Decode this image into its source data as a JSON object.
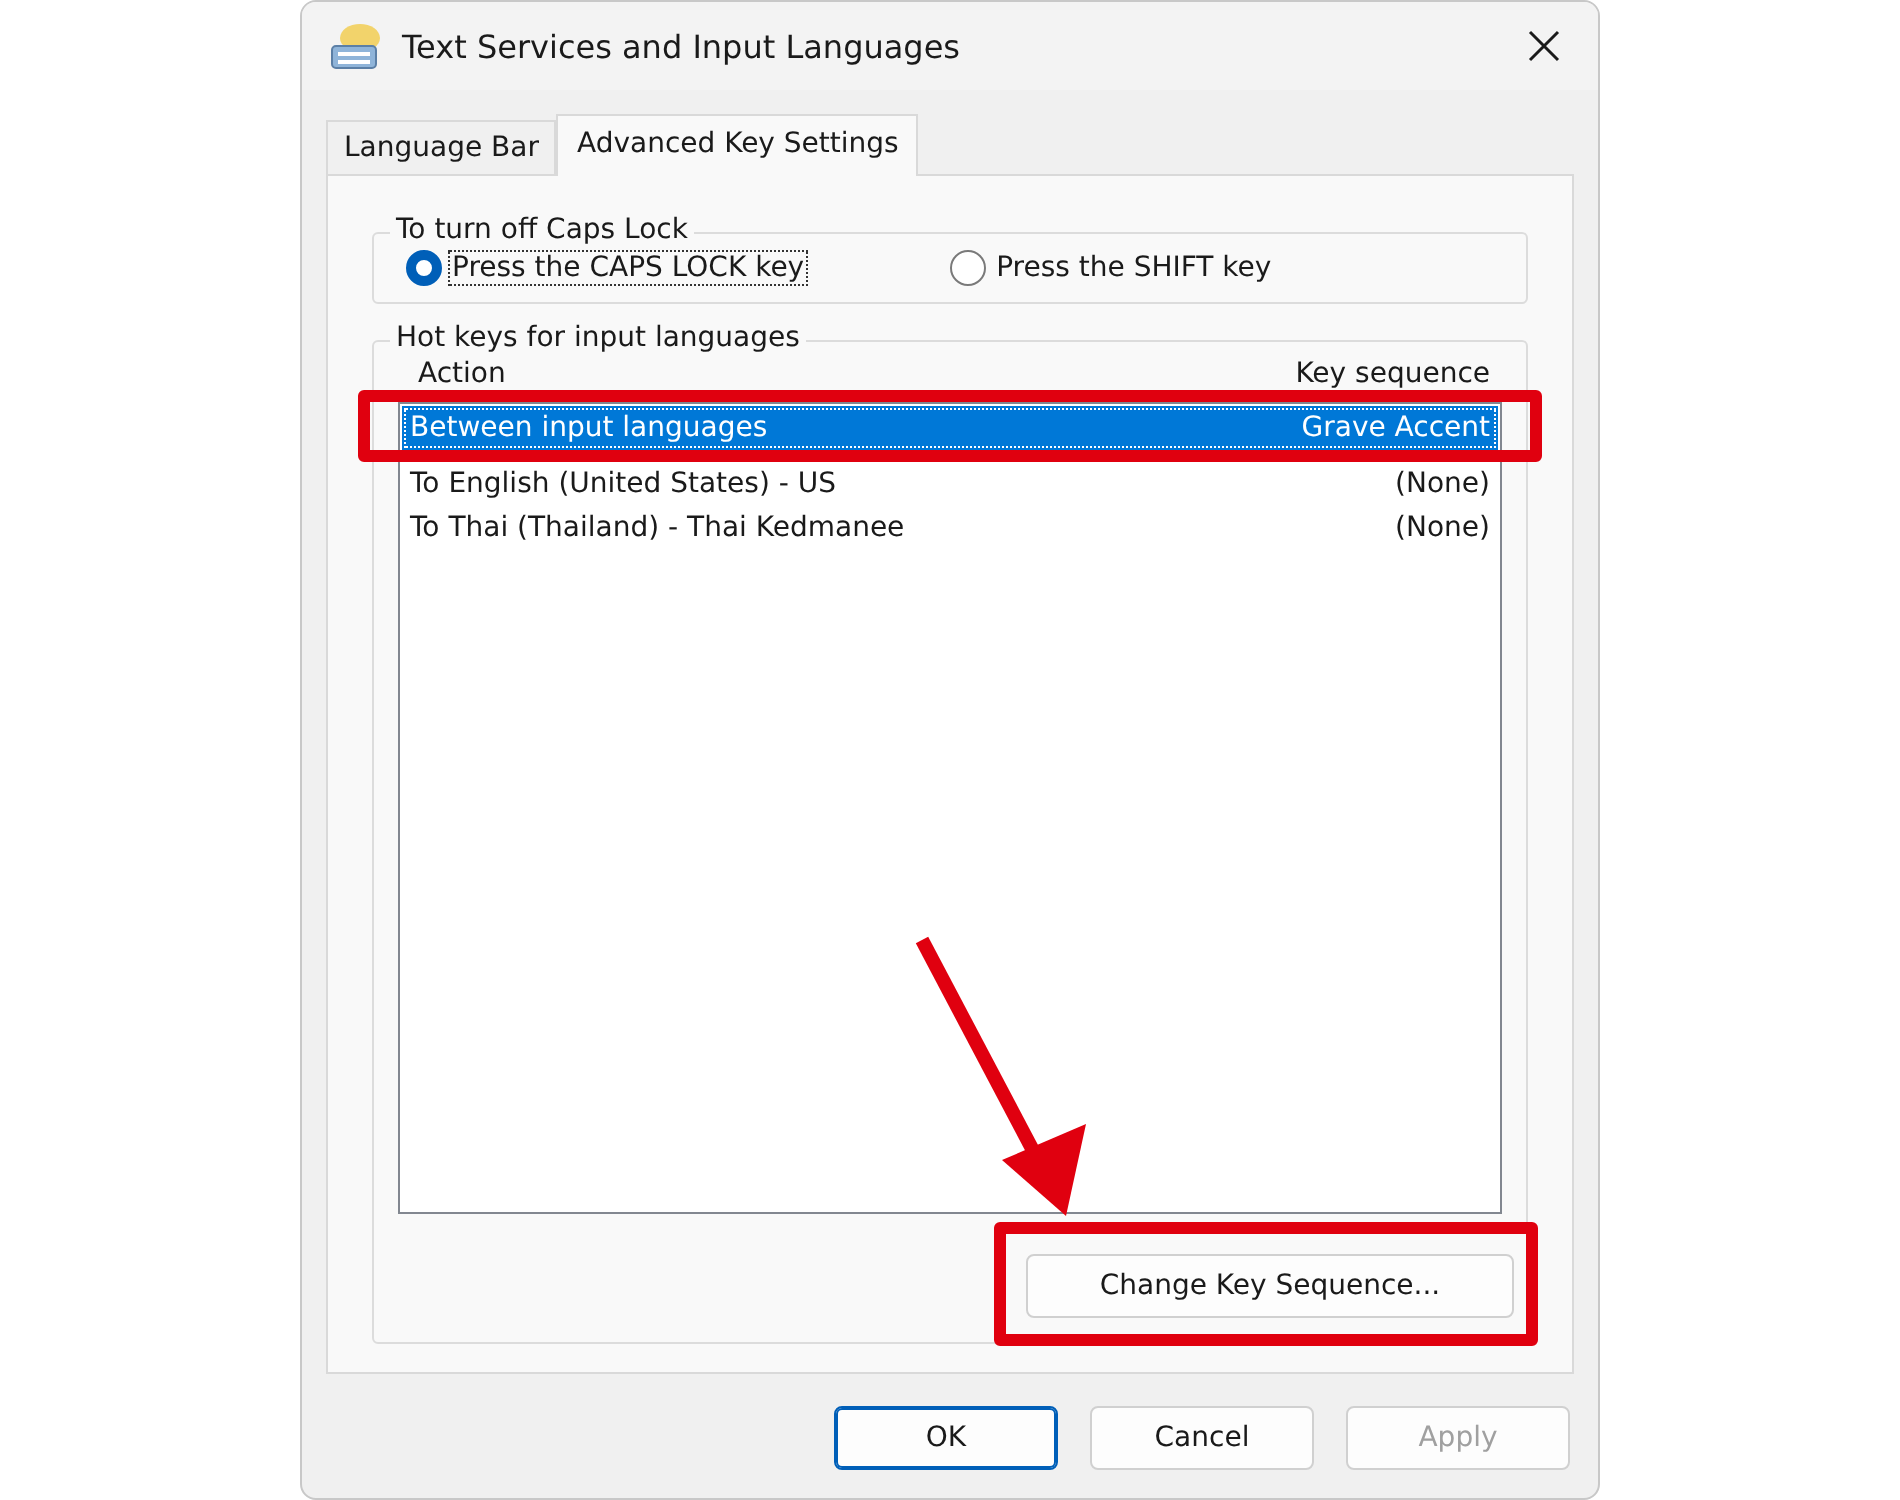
{
  "window": {
    "title": "Text Services and Input Languages"
  },
  "tabs": [
    {
      "label": "Language Bar",
      "selected": false
    },
    {
      "label": "Advanced Key Settings",
      "selected": true
    }
  ],
  "caps_lock": {
    "legend": "To turn off Caps Lock",
    "options": [
      {
        "label": "Press the CAPS LOCK key",
        "selected": true,
        "focused": true
      },
      {
        "label": "Press the SHIFT key",
        "selected": false,
        "focused": false
      }
    ]
  },
  "hot_keys": {
    "legend": "Hot keys for input languages",
    "columns": [
      "Action",
      "Key sequence"
    ],
    "rows": [
      {
        "action": "Between input languages",
        "key_sequence": "Grave Accent",
        "selected": true,
        "highlighted": true
      },
      {
        "action": "To English (United States) - US",
        "key_sequence": "(None)",
        "selected": false,
        "highlighted": false
      },
      {
        "action": "To Thai (Thailand) - Thai Kedmanee",
        "key_sequence": "(None)",
        "selected": false,
        "highlighted": false
      }
    ],
    "change_button": {
      "label": "Change Key Sequence...",
      "highlighted": true,
      "arrow": true
    }
  },
  "buttons": [
    {
      "label": "OK",
      "default": true,
      "disabled": false
    },
    {
      "label": "Cancel",
      "default": false,
      "disabled": false
    },
    {
      "label": "Apply",
      "default": false,
      "disabled": true
    }
  ]
}
